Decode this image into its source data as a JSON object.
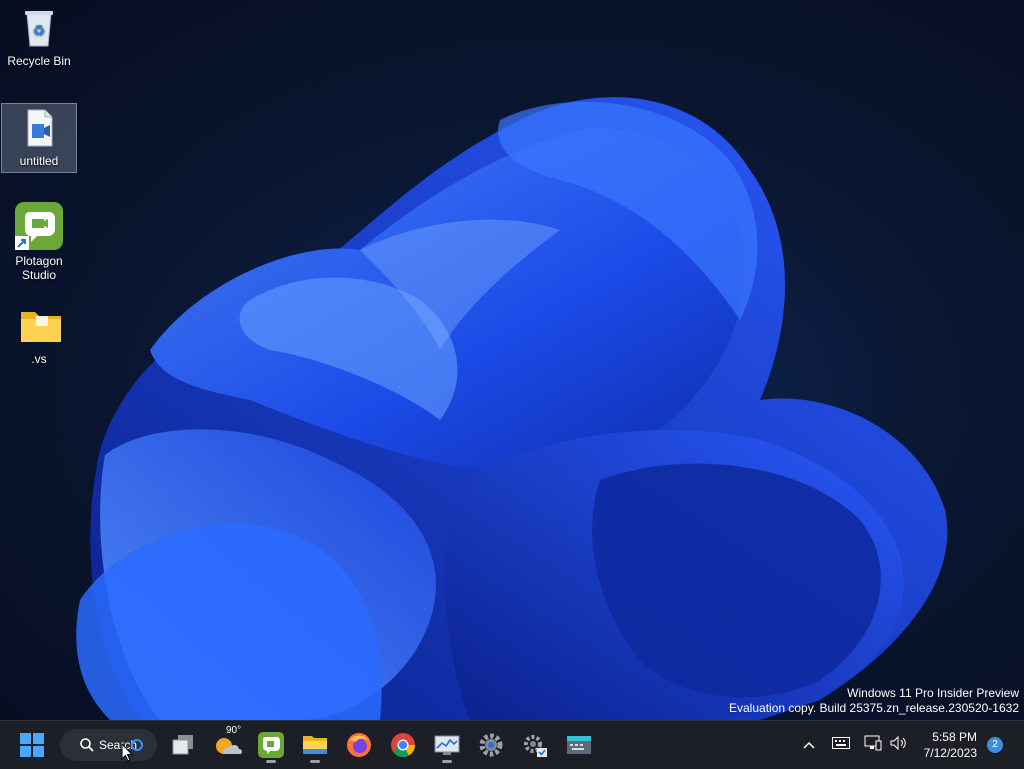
{
  "desktop": {
    "icons": [
      {
        "label": "Recycle Bin",
        "icon": "recycle-bin-icon"
      },
      {
        "label": "untitled",
        "icon": "video-file-icon"
      },
      {
        "label": "Plotagon Studio",
        "icon": "plotagon-icon"
      },
      {
        "label": ".vs",
        "icon": "folder-icon"
      }
    ]
  },
  "watermark": {
    "line1": "Windows 11 Pro Insider Preview",
    "line2": "Evaluation copy. Build 25375.zn_release.230520-1632"
  },
  "taskbar": {
    "search_label": "Search",
    "weather_temp": "90°",
    "apps": [
      "start-icon",
      "task-view-icon",
      "weather-icon",
      "plotagon-icon",
      "file-explorer-icon",
      "firefox-icon",
      "chrome-icon",
      "performance-monitor-icon",
      "settings-icon",
      "settings-alt-icon",
      "keyboard-app-icon"
    ]
  },
  "tray": {
    "time": "5:58 PM",
    "date": "7/12/2023",
    "notifications": "2"
  }
}
